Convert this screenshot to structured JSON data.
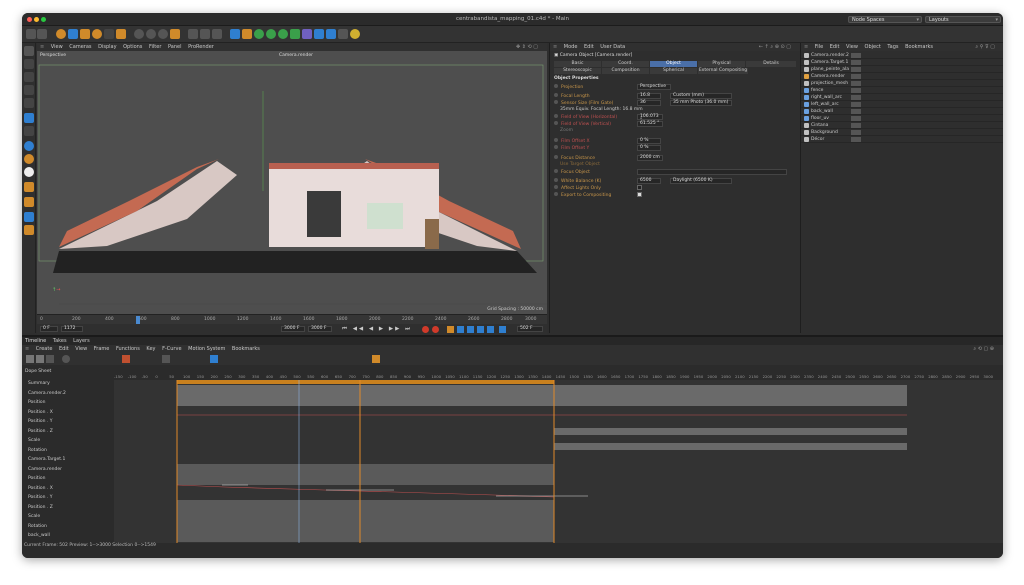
{
  "window": {
    "title": "centrabandista_mapping_01.c4d * - Main",
    "node_spaces": "Node Spaces",
    "layouts": "Layouts"
  },
  "viewport": {
    "menu": [
      "View",
      "Cameras",
      "Display",
      "Options",
      "Filter",
      "Panel",
      "ProRender"
    ],
    "label": "Perspective",
    "camera": "Camera.render",
    "grid_spacing": "Grid Spacing : 50000 cm"
  },
  "ruler_ticks": [
    "0",
    "200",
    "400",
    "600",
    "800",
    "1000",
    "1200",
    "1400",
    "1600",
    "1800",
    "2000",
    "2200",
    "2400",
    "2600",
    "2800",
    "3000"
  ],
  "transport": {
    "start": "0 F",
    "current": "1172",
    "end_a": "3000 F",
    "end_b": "3000 F",
    "frame_field": "502 F"
  },
  "attributes": {
    "menu": [
      "Mode",
      "Edit",
      "User Data"
    ],
    "header": "Camera Object [Camera.render]",
    "tabs_row1": [
      "Basic",
      "Coord.",
      "Object",
      "Physical",
      "Details"
    ],
    "tabs_row2": [
      "Stereoscopic",
      "Composition",
      "Spherical",
      "External Compositing"
    ],
    "section": "Object Properties",
    "rows": [
      {
        "label": "Projection",
        "value": "Perspective",
        "orange": true
      },
      {
        "label": "Focal Length",
        "value": "16.8",
        "extra": "Custom (mm)",
        "orange": true
      },
      {
        "label": "Sensor Size (Film Gate)",
        "value": "36",
        "extra": "35 mm Photo (36.0 mm)",
        "orange": true
      },
      {
        "label": "35mm Equiv. Focal Length: 16.8 mm",
        "value": "",
        "orange": false
      },
      {
        "label": "Field of View (Horizontal)",
        "value": "106.073 °",
        "orange": true
      },
      {
        "label": "Field of View (Vertical)",
        "value": "61.525 °",
        "orange": true
      },
      {
        "label": "Zoom",
        "value": "",
        "orange": false
      },
      {
        "label": "Film Offset X",
        "value": "0 %",
        "orange": true
      },
      {
        "label": "Film Offset Y",
        "value": "0 %",
        "orange": true
      },
      {
        "label": "Focus Distance",
        "value": "2000 cm",
        "orange": true
      },
      {
        "label": "Use Target Object",
        "value": "",
        "orange": true
      },
      {
        "label": "Focus Object",
        "value": "",
        "orange": true
      },
      {
        "label": "White Balance (K)",
        "value": "6500",
        "extra": "Daylight (6500 K)",
        "orange": true
      },
      {
        "label": "Affect Lights Only",
        "value": "",
        "orange": true
      },
      {
        "label": "Export to Compositing",
        "value": "",
        "orange": true
      }
    ]
  },
  "objects": {
    "menu": [
      "File",
      "Edit",
      "View",
      "Object",
      "Tags",
      "Bookmarks"
    ],
    "items": [
      {
        "name": "Camera.render.2",
        "color": "#c0c0c0"
      },
      {
        "name": "Camera.Target.1",
        "color": "#c0c0c0"
      },
      {
        "name": "plane_peinte_ala",
        "color": "#c0c0c0"
      },
      {
        "name": "Camera.render",
        "color": "#e0a040"
      },
      {
        "name": "projection_mesh",
        "color": "#c0c0c0"
      },
      {
        "name": "fence",
        "color": "#6aa0e0"
      },
      {
        "name": "right_wall_arc",
        "color": "#6aa0e0"
      },
      {
        "name": "left_wall_arc",
        "color": "#6aa0e0"
      },
      {
        "name": "back_wall",
        "color": "#6aa0e0"
      },
      {
        "name": "floor_uv",
        "color": "#6aa0e0"
      },
      {
        "name": "Cintana",
        "color": "#c0c0c0"
      },
      {
        "name": "Background",
        "color": "#c0c0c0"
      },
      {
        "name": "Décor",
        "color": "#c0c0c0"
      }
    ]
  },
  "timeline": {
    "tabs": [
      "Timeline",
      "Takes",
      "Layers"
    ],
    "menu": [
      "Create",
      "Edit",
      "View",
      "Frame",
      "Functions",
      "Key",
      "F-Curve",
      "Motion System",
      "Bookmarks"
    ],
    "dope_sheet": "Dope Sheet",
    "tracks": [
      "Summary",
      "Camera.render.2",
      "Position",
      "Position . X",
      "Position . Y",
      "Position . Z",
      "Scale",
      "Rotation",
      "Camera.Target.1",
      "Camera.render",
      "Position",
      "Position . X",
      "Position . Y",
      "Position . Z",
      "Scale",
      "Rotation",
      "back_wall"
    ],
    "frame_labels": [
      "-150",
      "-100",
      "-50",
      "0",
      "50",
      "100",
      "150",
      "200",
      "250",
      "300",
      "350",
      "400",
      "450",
      "500",
      "550",
      "600",
      "650",
      "700",
      "750",
      "800",
      "850",
      "900",
      "950",
      "1000",
      "1050",
      "1100",
      "1150",
      "1200",
      "1250",
      "1300",
      "1350",
      "1400",
      "1450",
      "1500",
      "1550",
      "1600",
      "1650",
      "1700",
      "1750",
      "1800",
      "1850",
      "1900",
      "1950",
      "2000",
      "2050",
      "2100",
      "2150",
      "2200",
      "2250",
      "2300",
      "2350",
      "2400",
      "2450",
      "2500",
      "2550",
      "2600",
      "2650",
      "2700",
      "2750",
      "2800",
      "2850",
      "2900",
      "2950",
      "3000"
    ],
    "status": "Current Frame: 502  Preview: 1-->3000  Selection 0-->1549"
  }
}
